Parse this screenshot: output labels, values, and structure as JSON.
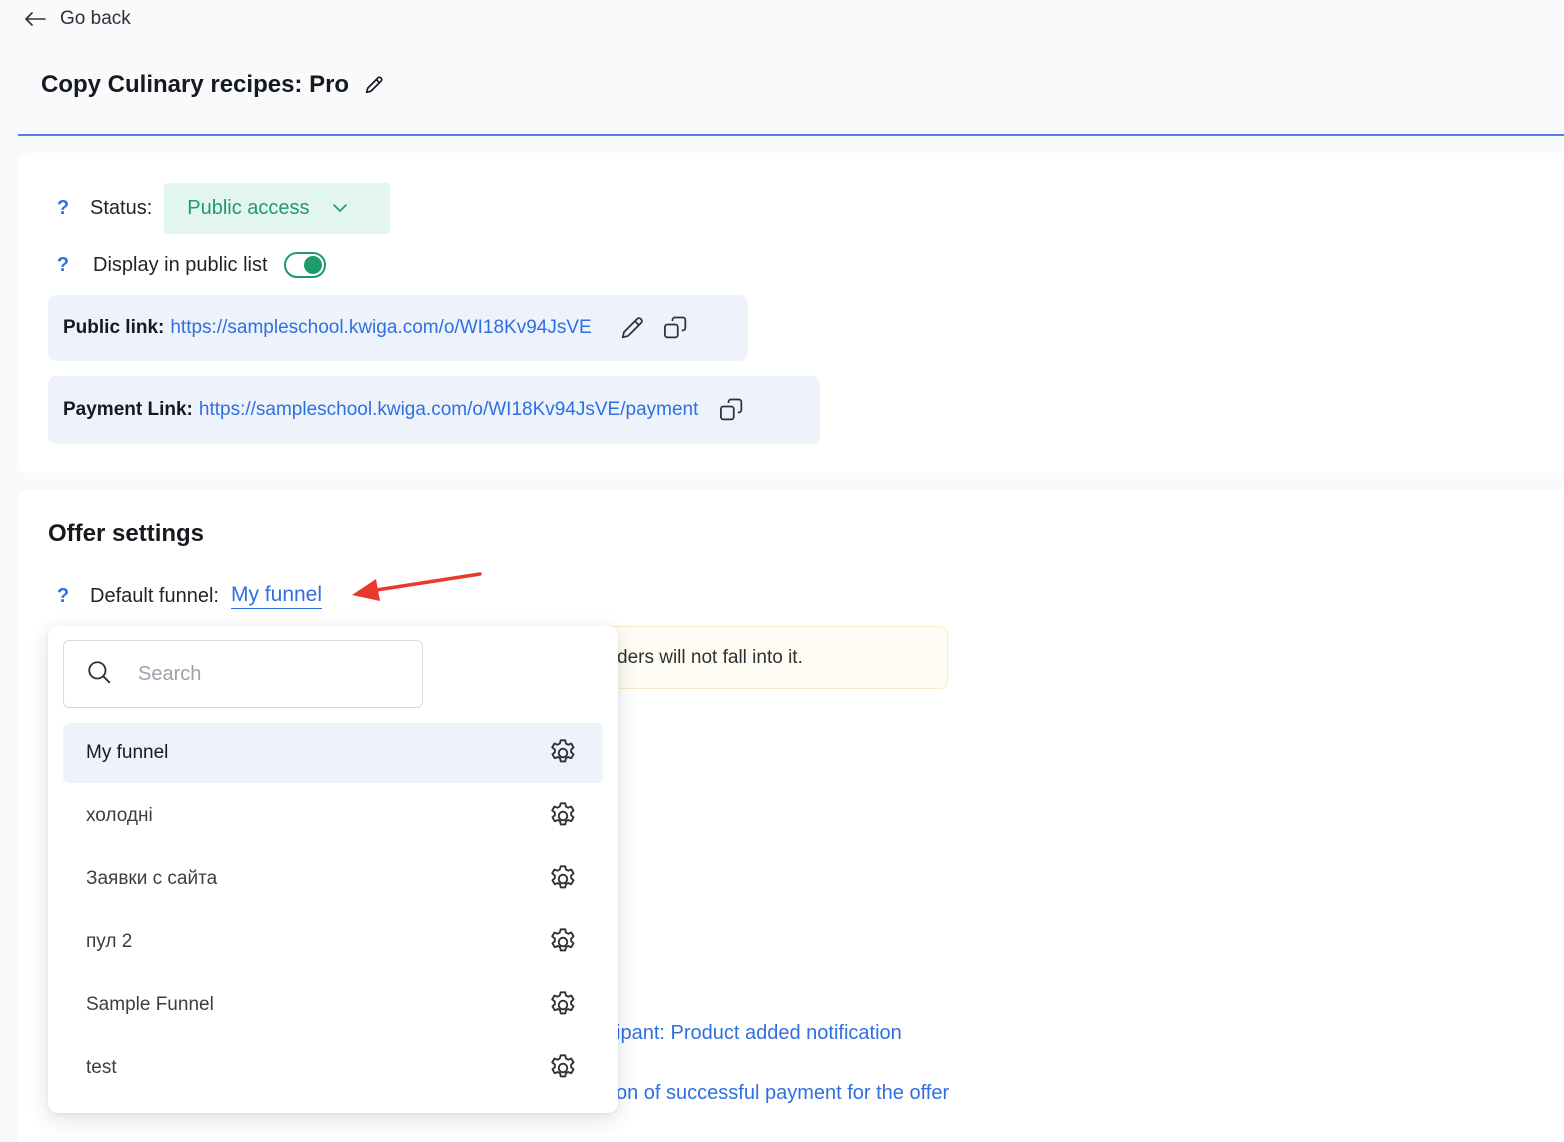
{
  "nav": {
    "go_back_label": "Go back"
  },
  "page": {
    "title": "Copy Culinary recipes: Pro"
  },
  "status": {
    "help": "?",
    "label": "Status:",
    "value": "Public access"
  },
  "display_public": {
    "help": "?",
    "label": "Display in public list",
    "enabled": true
  },
  "links": {
    "public_label": "Public link:",
    "public_url": "https://sampleschool.kwiga.com/o/WI18Kv94JsVE",
    "payment_label": "Payment Link:",
    "payment_url": "https://sampleschool.kwiga.com/o/WI18Kv94JsVE/payment"
  },
  "offer": {
    "heading": "Offer settings",
    "funnel_help": "?",
    "funnel_label": "Default funnel:",
    "funnel_value": "My funnel",
    "warning_partial": "ders will not fall into it.",
    "link_partial_1": "ipant: Product added notification",
    "link_partial_2": "on of successful payment for the offer"
  },
  "dropdown": {
    "search_placeholder": "Search",
    "items": [
      {
        "label": "My funnel",
        "selected": true
      },
      {
        "label": "холодні",
        "selected": false
      },
      {
        "label": "Заявки с сайта",
        "selected": false
      },
      {
        "label": "пул 2",
        "selected": false
      },
      {
        "label": "Sample Funnel",
        "selected": false
      },
      {
        "label": "test",
        "selected": false
      }
    ]
  },
  "colors": {
    "accent": "#2f6fe0",
    "success": "#1f9a6a",
    "success_bg": "#e3f5ef",
    "annotation": "#e8392c"
  },
  "icons": [
    "arrow-left-icon",
    "pencil-icon",
    "chevron-down-icon",
    "copy-icon",
    "search-icon",
    "gear-icon"
  ]
}
